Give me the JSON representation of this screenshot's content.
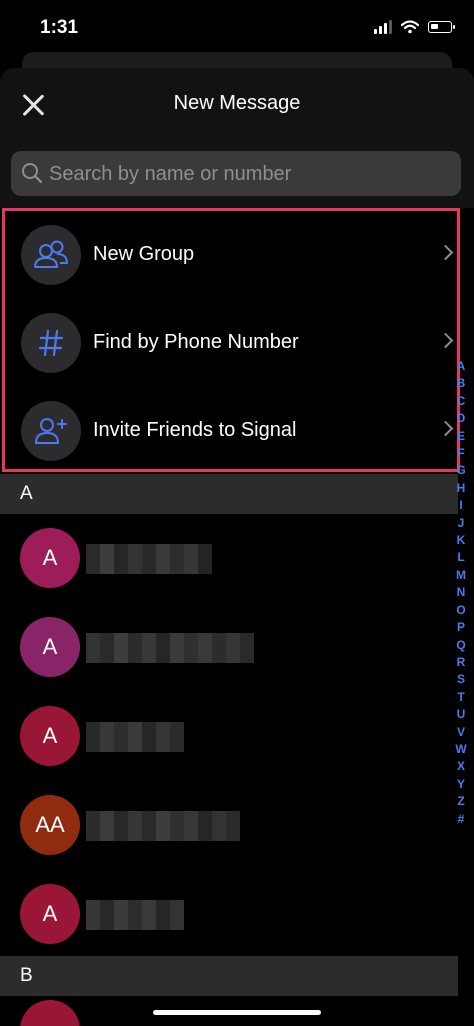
{
  "status": {
    "time": "1:31"
  },
  "header": {
    "title": "New Message",
    "close_icon": "close-icon"
  },
  "search": {
    "placeholder": "Search by name or number",
    "value": ""
  },
  "actions": [
    {
      "label": "New Group",
      "icon": "group-icon"
    },
    {
      "label": "Find by Phone Number",
      "icon": "hash-icon"
    },
    {
      "label": "Invite Friends to Signal",
      "icon": "add-person-icon"
    }
  ],
  "sections": [
    {
      "letter": "A"
    },
    {
      "letter": "B"
    }
  ],
  "contacts": [
    {
      "initials": "A",
      "color": "#9c1d5a"
    },
    {
      "initials": "A",
      "color": "#8a2468"
    },
    {
      "initials": "A",
      "color": "#9a1636"
    },
    {
      "initials": "AA",
      "color": "#8f2b0f"
    },
    {
      "initials": "A",
      "color": "#9a1636"
    }
  ],
  "alphabet": [
    "A",
    "B",
    "C",
    "D",
    "E",
    "F",
    "G",
    "H",
    "I",
    "J",
    "K",
    "L",
    "M",
    "N",
    "O",
    "P",
    "Q",
    "R",
    "S",
    "T",
    "U",
    "V",
    "W",
    "X",
    "Y",
    "Z",
    "#"
  ],
  "colors": {
    "accent": "#4a7cf0",
    "highlight": "#e8365d",
    "background": "#000000"
  }
}
